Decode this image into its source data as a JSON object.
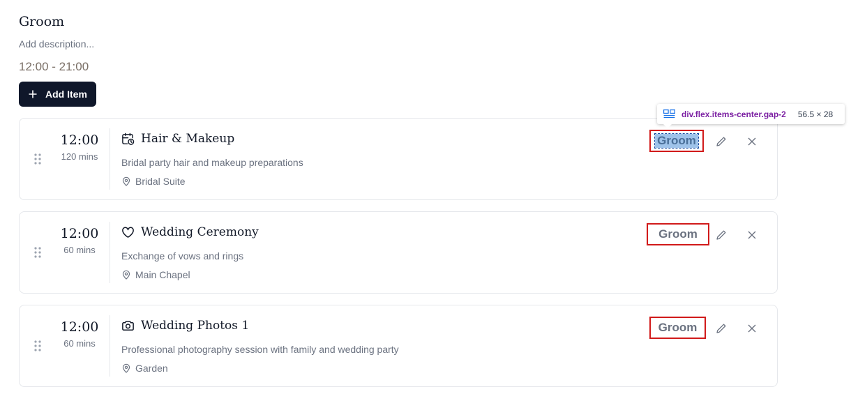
{
  "header": {
    "title": "Groom",
    "description_placeholder": "Add description...",
    "time_range": "12:00 - 21:00",
    "add_item_label": "Add Item"
  },
  "tooltip": {
    "selector": "div.flex.items-center.gap-2",
    "size": "56.5 × 28"
  },
  "items": [
    {
      "time": "12:00",
      "duration": "120 mins",
      "icon": "calendar-clock-icon",
      "title": "Hair & Makeup",
      "description": "Bridal party hair and makeup preparations",
      "location": "Bridal Suite",
      "tag": "Groom"
    },
    {
      "time": "12:00",
      "duration": "60 mins",
      "icon": "heart-icon",
      "title": "Wedding Ceremony",
      "description": "Exchange of vows and rings",
      "location": "Main Chapel",
      "tag": "Groom"
    },
    {
      "time": "12:00",
      "duration": "60 mins",
      "icon": "camera-icon",
      "title": "Wedding Photos 1",
      "description": "Professional photography session with family and wedding party",
      "location": "Garden",
      "tag": "Groom"
    }
  ],
  "colors": {
    "primary_button": "#0f172a",
    "highlight_border": "#d11a1a",
    "selection_fill": "#9fc3ea",
    "muted_text": "#6b7280"
  }
}
